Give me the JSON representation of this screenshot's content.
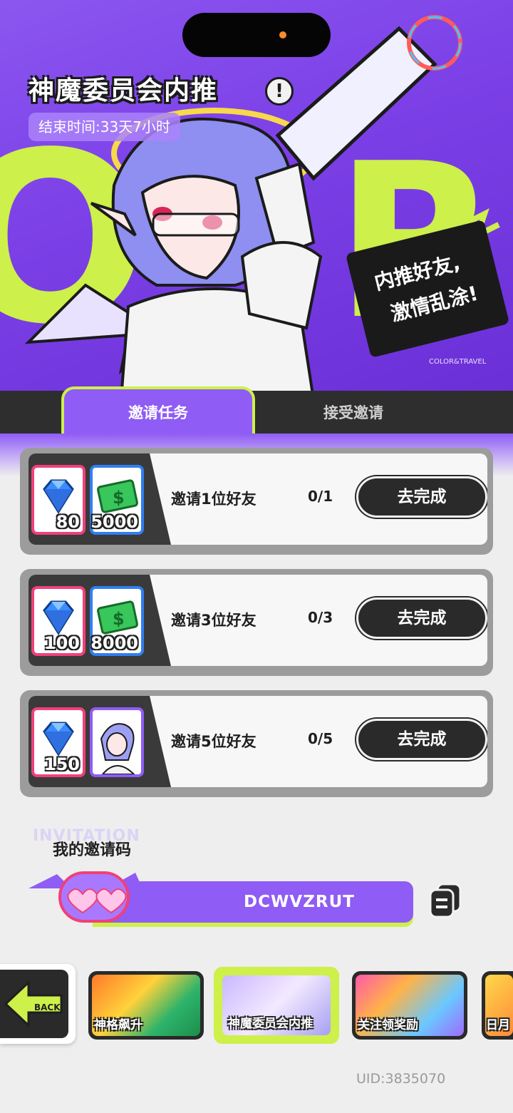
{
  "header": {
    "title": "神魔委员会内推",
    "end_time": "结束时间:33天7小时",
    "slogan_line1": "内推好友,",
    "slogan_line2": "激情乱涂!",
    "brand": "COLOR&TRAVEL"
  },
  "tabs": [
    {
      "label": "邀请任务",
      "active": true
    },
    {
      "label": "接受邀请",
      "active": false
    }
  ],
  "tasks": [
    {
      "label": "邀请1位好友",
      "progress": "0/1",
      "button": "去完成",
      "rewards": [
        {
          "type": "gem-icon",
          "count": "80"
        },
        {
          "type": "cash-icon",
          "count": "5000"
        }
      ]
    },
    {
      "label": "邀请3位好友",
      "progress": "0/3",
      "button": "去完成",
      "rewards": [
        {
          "type": "gem-icon",
          "count": "100"
        },
        {
          "type": "cash-icon",
          "count": "8000"
        }
      ]
    },
    {
      "label": "邀请5位好友",
      "progress": "0/5",
      "button": "去完成",
      "rewards": [
        {
          "type": "gem-icon",
          "count": "150"
        },
        {
          "type": "avatar-icon",
          "count": ""
        }
      ]
    }
  ],
  "invite": {
    "watermark": "INVITATION",
    "title": "我的邀请码",
    "code": "DCWVZRUT"
  },
  "nav": {
    "back_label": "BACK",
    "events": [
      "神格飙升",
      "神魔委员会内推",
      "关注领奖励",
      "日月"
    ]
  },
  "footer": {
    "uid": "UID:3835070"
  },
  "colors": {
    "accent_purple": "#8f5cf5",
    "accent_lime": "#cdf04a",
    "dark": "#2a2a2a",
    "gem_border": "#f0407a",
    "cash_border": "#2f7ff0"
  }
}
